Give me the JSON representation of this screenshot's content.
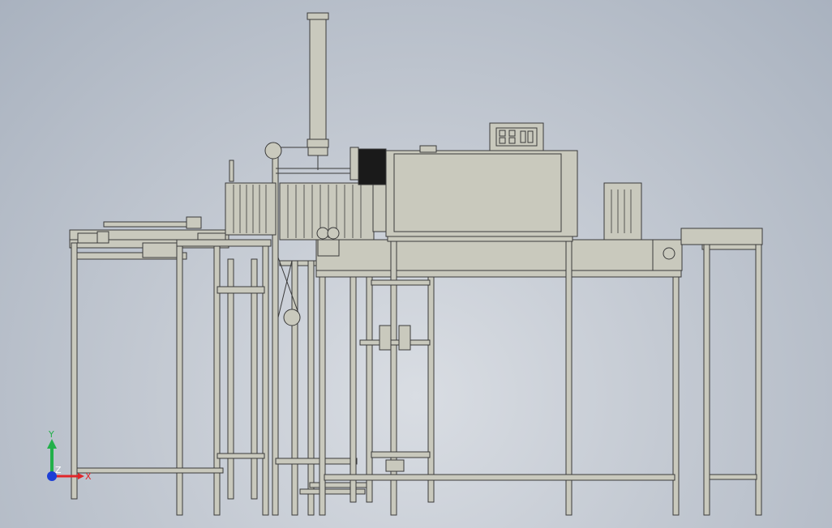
{
  "viewport": {
    "background_top": "#a9b2bf",
    "background_center": "#d9dde3"
  },
  "model": {
    "frame_color": "#c9c9bd",
    "outline_color": "#3a3a3a",
    "dark_panel_color": "#1a1a1a"
  },
  "triad": {
    "x_label": "X",
    "y_label": "Y",
    "z_label": "Z",
    "x_color": "#e0262a",
    "y_color": "#22b04a",
    "z_color": "#1d3fd6"
  }
}
